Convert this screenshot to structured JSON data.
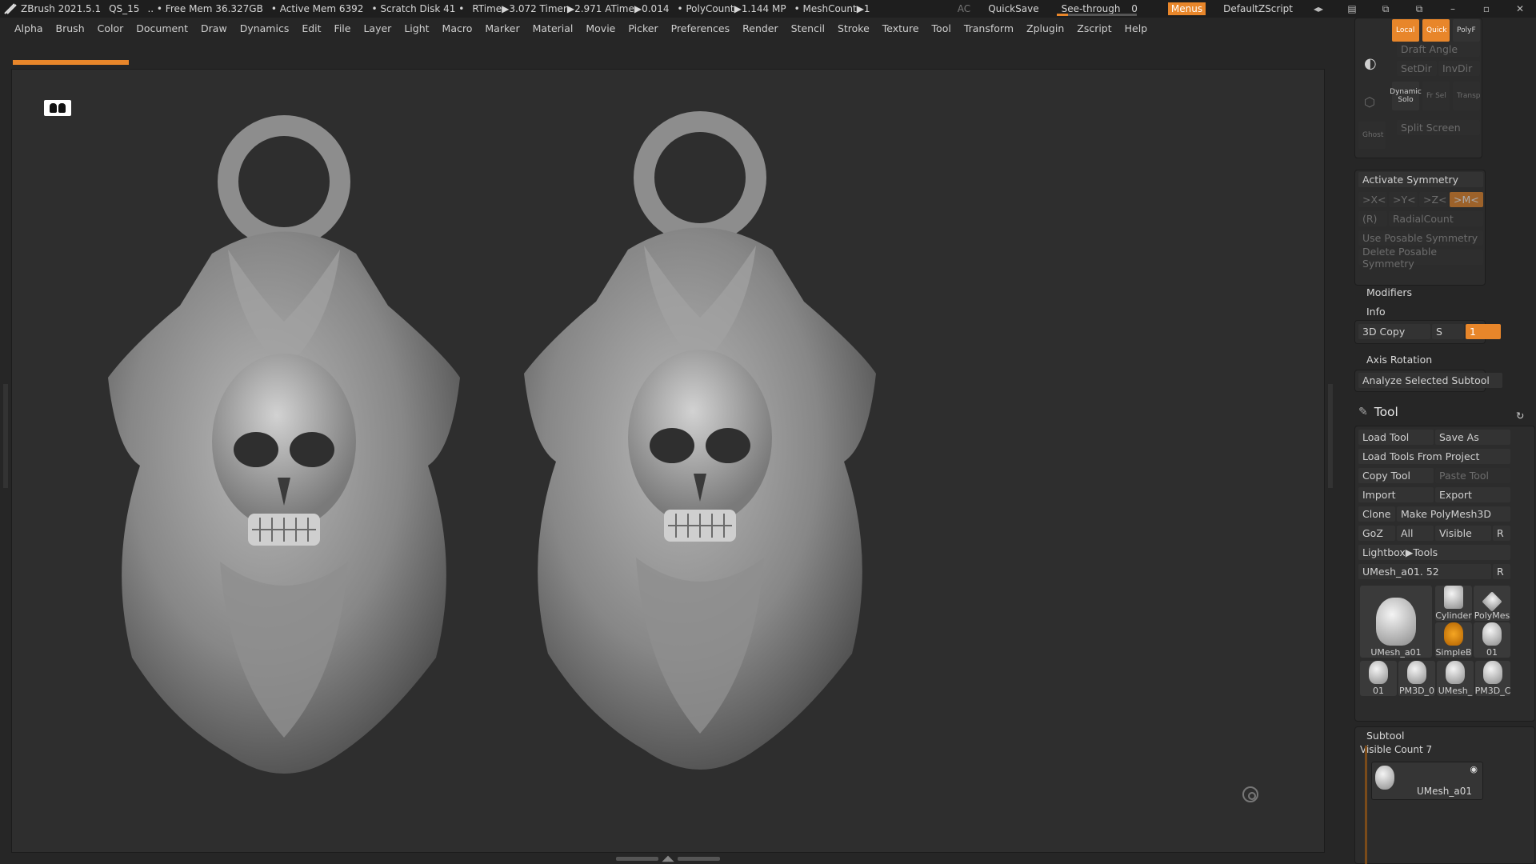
{
  "titlebar": {
    "app": "ZBrush 2021.5.1",
    "project": "QS_15",
    "free_mem": "..  • Free Mem 36.327GB",
    "active_mem": "• Active Mem 6392",
    "scratch": "• Scratch Disk 41  •",
    "rtime": "RTime▶3.072 Timer▶2.971 ATime▶0.014",
    "polycount": "• PolyCount▶1.144 MP",
    "meshcount": "• MeshCount▶1",
    "ac": "AC",
    "quicksave": "QuickSave",
    "see_through_label": "See-through",
    "see_through_value": "0",
    "see_through_level": 0.0,
    "menus": "Menus",
    "script": "DefaultZScript"
  },
  "menubar": [
    "Alpha",
    "Brush",
    "Color",
    "Document",
    "Draw",
    "Dynamics",
    "Edit",
    "File",
    "Layer",
    "Light",
    "Macro",
    "Marker",
    "Material",
    "Movie",
    "Picker",
    "Preferences",
    "Render",
    "Stencil",
    "Stroke",
    "Texture",
    "Tool",
    "Transform",
    "Zplugin",
    "Zscript",
    "Help"
  ],
  "panel": {
    "top_buttons": [
      "Local",
      "Quick",
      "PolyF"
    ],
    "draft_angle": "Draft Angle",
    "setdir": "SetDir",
    "invdir": "InvDir",
    "dynamic": "Dynamic",
    "solo": "Solo",
    "frsel": "Fr Sel",
    "transp": "Transp",
    "ghost": "Ghost",
    "split_screen": "Split Screen",
    "activate_symmetry": "Activate Symmetry",
    "sym_x": ">X<",
    "sym_y": ">Y<",
    "sym_z": ">Z<",
    "sym_m": ">M<",
    "sym_r": "(R)",
    "radial_count": "RadialCount",
    "use_posable": "Use Posable Symmetry",
    "delete_posable": "Delete Posable Symmetry",
    "modifiers": "Modifiers",
    "info": "Info",
    "copy3d": "3D Copy",
    "copy3d_s": "S",
    "copy3d_value": "1",
    "axis_rotation": "Axis Rotation",
    "analyze": "Analyze Selected Subtool",
    "tool": "Tool",
    "load_tool": "Load Tool",
    "save_as": "Save As",
    "load_from_project": "Load Tools From Project",
    "copy_tool": "Copy Tool",
    "paste_tool": "Paste Tool",
    "import": "Import",
    "export": "Export",
    "clone": "Clone",
    "make_polymesh": "Make PolyMesh3D",
    "goz": "GoZ",
    "all": "All",
    "visible": "Visible",
    "r": "R",
    "lightbox_tools": "Lightbox▶Tools",
    "current_tool": "UMesh_a01. 52",
    "thumbs": [
      "UMesh_a01",
      "Cylinder",
      "PolyMes",
      "SimpleB",
      "01",
      "01",
      "PM3D_0",
      "UMesh_",
      "PM3D_C"
    ],
    "subtool": "Subtool",
    "visible_count": "Visible Count 7",
    "subtool_item": "UMesh_a01"
  }
}
